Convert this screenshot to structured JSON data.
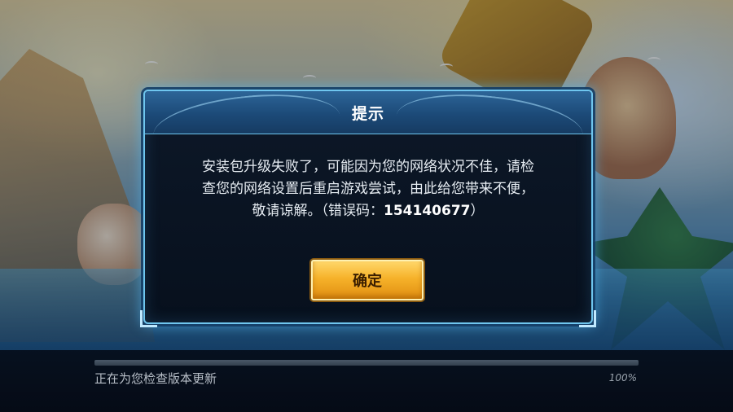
{
  "dialog": {
    "title": "提示",
    "message_line1": "安装包升级失败了，可能因为您的网络状况不佳，请检",
    "message_line2": "查您的网络设置后重启游戏尝试，由此给您带来不便，",
    "message_line3_prefix": "敬请谅解。（错误码：",
    "error_code": "154140677",
    "message_line3_suffix": "）",
    "confirm_label": "确定"
  },
  "loading": {
    "status_text": "正在为您检查版本更新",
    "percent_text": "100%",
    "progress": 1.0
  },
  "colors": {
    "dialog_border": "#6fc6ef",
    "header_blue": "#2d6598",
    "button_gold": "#f6b22a"
  }
}
